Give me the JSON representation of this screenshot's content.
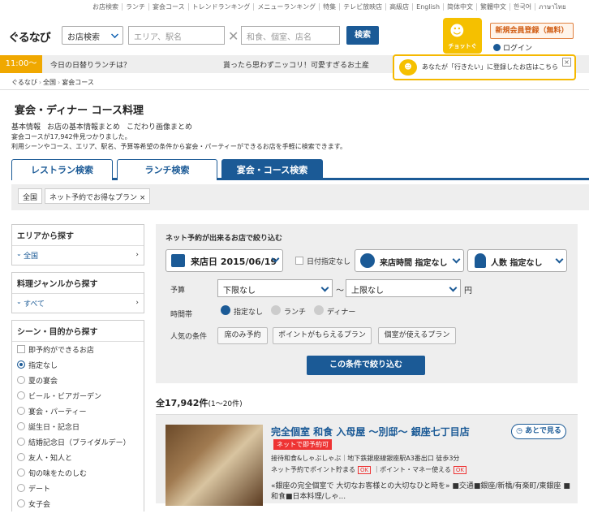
{
  "topnav": [
    "お店検索",
    "ランチ",
    "宴会コース",
    "トレンドランキング",
    "メニューランキング",
    "特集",
    "テレビ放映店",
    "高級店",
    "English",
    "简体中文",
    "繁體中文",
    "한국어",
    "ภาษาไทย"
  ],
  "logo": "ぐるなび",
  "search": {
    "select_label": "お店検索",
    "area_placeholder": "エリア、駅名",
    "keyword_placeholder": "和食、個室、店名",
    "button": "検索"
  },
  "chotto": "チョットぐ",
  "register": "新規会員登録（無料）",
  "login": "ログイン",
  "infobar": {
    "time": "11:00〜",
    "lunch": "今日の日替りランチは？",
    "souvenir": "貰ったら思わずニッコリ！可愛すぎるお土産"
  },
  "popup": "あなたが「行きたい」に登録したお店はこちら",
  "breadcrumb": [
    "ぐるなび",
    "全国",
    "宴会コース"
  ],
  "page_title": "宴会・ディナー コース料理",
  "sublinks": [
    "基本情報",
    "お店の基本情報まとめ",
    "こだわり画像まとめ"
  ],
  "desc1": "宴会コースが17,942件見つかりました。",
  "desc2": "利用シーンやコース、エリア、駅名、予算等希望の条件から宴会・パーティーができるお店を手軽に検索できます。",
  "tabs": [
    "レストラン検索",
    "ランチ検索",
    "宴会・コース検索"
  ],
  "chips": [
    "全国",
    "ネット予約でお得なプラン ×"
  ],
  "left": {
    "area_title": "エリアから探す",
    "area_item": "全国",
    "genre_title": "料理ジャンルから探す",
    "genre_item": "すべて",
    "scene_title": "シーン・目的から探す",
    "instant": "即予約ができるお店",
    "scenes": [
      "指定なし",
      "夏の宴会",
      "ビール・ビアガーデン",
      "宴会・パーティー",
      "誕生日・記念日",
      "結婚記念日（ブライダルデー）",
      "友人・知人と",
      "旬の味をたのしむ",
      "デート",
      "女子会"
    ]
  },
  "panel": {
    "title": "ネット予約が出来るお店で絞り込む",
    "date_label": "来店日",
    "date": "2015/06/19",
    "no_date": "日付指定なし",
    "time_label": "来店時間",
    "time_value": "指定なし",
    "people_label": "人数",
    "people_value": "指定なし",
    "budget_label": "予算",
    "budget_min": "下限なし",
    "tilde": "〜",
    "budget_max": "上限なし",
    "yen": "円",
    "timeslot_label": "時間帯",
    "timeslots": [
      "指定なし",
      "ランチ",
      "ディナー"
    ],
    "popular_label": "人気の条件",
    "popular": [
      "席のみ予約",
      "ポイントがもらえるプラン",
      "個室が使えるプラン"
    ],
    "submit": "この条件で絞り込む"
  },
  "results": {
    "count": "全17,942件",
    "range": "(1〜20件)"
  },
  "card": {
    "name": "完全個室 和食 入母屋 〜別邸〜 銀座七丁目店",
    "badge": "ネットで即予約可",
    "later": "あとで見る",
    "meta1": "接待和食&しゃぶしゃぶ｜地下鉄銀座線銀座駅A3番出口 徒歩3分",
    "meta2a": "ネット予約でポイント貯まる",
    "meta2b": "ポイント・マネー使える",
    "ok": "OK",
    "blurb": "«銀座の完全個室で 大切なお客様との大切なひと時を» ■交通■銀座/新橋/有楽町/東銀座 ■和食■日本料理/しゃ..."
  }
}
